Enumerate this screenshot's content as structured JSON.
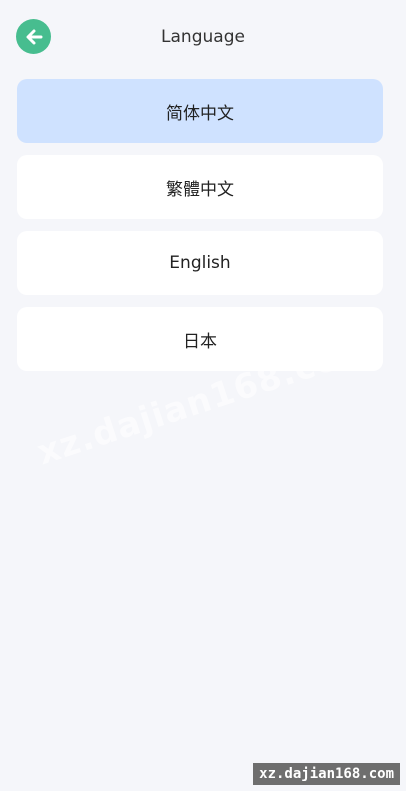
{
  "header": {
    "back_icon": "arrow-left-icon",
    "title": "Language"
  },
  "languages": [
    {
      "label": "简体中文",
      "selected": true
    },
    {
      "label": "繁體中文",
      "selected": false
    },
    {
      "label": "English",
      "selected": false
    },
    {
      "label": "日本",
      "selected": false
    }
  ],
  "colors": {
    "accent": "#47bd8f",
    "selected_bg": "#cfe2ff",
    "page_bg": "#f5f6fa"
  },
  "watermark": {
    "diagonal_text": "xz.dajian168.com",
    "tag_text": "xz.dajian168.com"
  }
}
